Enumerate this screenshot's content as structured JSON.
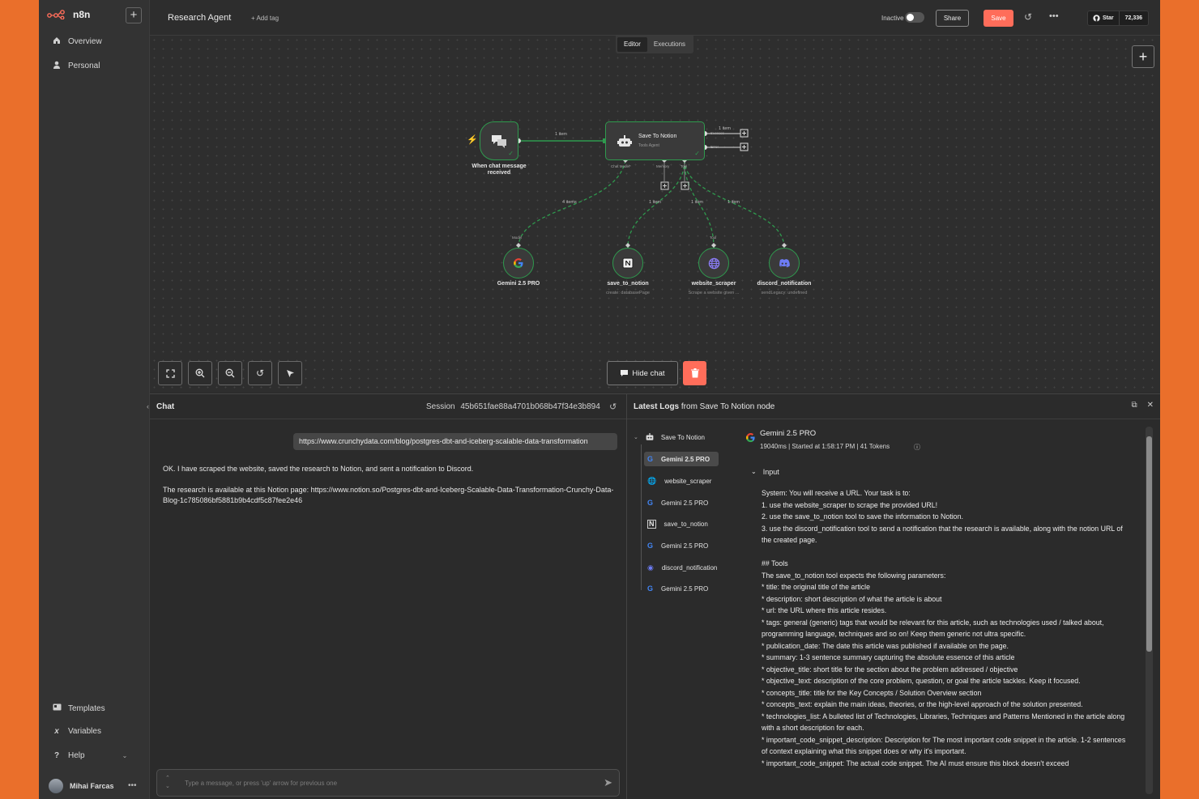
{
  "app": {
    "name": "n8n"
  },
  "sidebar": {
    "items": [
      {
        "label": "Overview",
        "icon": "home-icon"
      },
      {
        "label": "Personal",
        "icon": "user-icon"
      }
    ],
    "bottom_items": [
      {
        "label": "Templates",
        "icon": "templates-icon"
      },
      {
        "label": "Variables",
        "icon": "variables-icon"
      },
      {
        "label": "Help",
        "icon": "help-icon"
      }
    ],
    "user": "Mihai Farcas"
  },
  "header": {
    "workflow_title": "Research Agent",
    "add_tag": "+ Add tag",
    "status": "Inactive",
    "share": "Share",
    "save": "Save",
    "github_star": "Star",
    "github_count": "72,336"
  },
  "tabs": [
    {
      "label": "Editor"
    },
    {
      "label": "Executions"
    }
  ],
  "canvas": {
    "trigger": {
      "label_line1": "When chat message",
      "label_line2": "received"
    },
    "agent": {
      "title": "Save To Notion",
      "subtitle": "Tools Agent"
    },
    "ports": {
      "chat_model": "Chat Model*",
      "memory": "Memory",
      "tool": "Tool",
      "success": "Success",
      "error": "Error"
    },
    "edge_labels": {
      "main": "1 item",
      "success": "1 item",
      "model": "4 items",
      "notion": "1 item",
      "scraper": "1 item",
      "discord": "1 item"
    },
    "sub_port_labels": {
      "model": "Model",
      "tool": "Tool"
    },
    "sub_nodes": [
      {
        "label": "Gemini 2.5 PRO",
        "sub": "",
        "icon": "google-icon"
      },
      {
        "label": "save_to_notion",
        "sub": "create: databasePage",
        "icon": "notion-icon"
      },
      {
        "label": "website_scraper",
        "sub": "Scrape a website given ...",
        "icon": "globe-icon"
      },
      {
        "label": "discord_notification",
        "sub": "sendLegacy: undefined",
        "icon": "discord-icon"
      }
    ],
    "hide_chat": "Hide chat"
  },
  "chat": {
    "title": "Chat",
    "session_label": "Session",
    "session_id": "45b651fae88a4701b068b47f34e3b894",
    "user_message": "https://www.crunchydata.com/blog/postgres-dbt-and-iceberg-scalable-data-transformation",
    "bot_message_1": "OK. I have scraped the website, saved the research to Notion, and sent a notification to Discord.",
    "bot_message_2": "The research is available at this Notion page: https://www.notion.so/Postgres-dbt-and-Iceberg-Scalable-Data-Transformation-Crunchy-Data-Blog-1c785086bf5881b9b4cdf5c87fee2e46",
    "input_placeholder": "Type a message, or press 'up' arrow for previous one"
  },
  "logs": {
    "title_prefix": "Latest Logs",
    "title_suffix": "from Save To Notion node",
    "root": "Save To Notion",
    "items": [
      {
        "label": "Gemini 2.5 PRO",
        "icon": "google-icon",
        "selected": true
      },
      {
        "label": "website_scraper",
        "icon": "globe-icon",
        "selected": false
      },
      {
        "label": "Gemini 2.5 PRO",
        "icon": "google-icon",
        "selected": false
      },
      {
        "label": "save_to_notion",
        "icon": "notion-icon",
        "selected": false
      },
      {
        "label": "Gemini 2.5 PRO",
        "icon": "google-icon",
        "selected": false
      },
      {
        "label": "discord_notification",
        "icon": "discord-icon",
        "selected": false
      },
      {
        "label": "Gemini 2.5 PRO",
        "icon": "google-icon",
        "selected": false
      }
    ],
    "detail": {
      "title": "Gemini 2.5 PRO",
      "meta": "19040ms | Started at 1:58:17 PM | 41 Tokens",
      "input_label": "Input",
      "input_text": "System: You will receive a URL. Your task is to:\n1. use the website_scraper to scrape the provided URL!\n2. use the save_to_notion tool to save the information to Notion.\n3. use the discord_notification tool to send a notification that the research is available, along with the notion URL of the created page.\n\n## Tools\nThe save_to_notion tool expects the following parameters:\n* title: the original title of the article\n* description: short description of what the article is about\n* url: the URL where this article resides.\n* tags: general (generic) tags that would be relevant for this article, such as technologies used / talked about, programming language, techniques and so on! Keep them generic not ultra specific.\n* publication_date: The date this article was published if available on the page.\n* summary: 1-3 sentence summary capturing the absolute essence of this article\n* objective_title: short title for the section about the problem addressed / objective\n* objective_text: description of the core problem, question, or goal the article tackles. Keep it focused.\n* concepts_title: title for the Key Concepts / Solution Overview section\n* concepts_text: explain the main ideas, theories, or the high-level approach of the solution presented.\n* technologies_list: A bulleted list of Technologies, Libraries, Techniques and Patterns Mentioned in the article along with a short description for each.\n* important_code_snippet_description: Description for The most important code snippet in the article. 1-2 sentences of context explaining what this snippet does or why it's important.\n* important_code_snippet: The actual code snippet. The AI must ensure this block doesn't exceed"
    }
  },
  "colors": {
    "accent": "#ff6d5a",
    "success": "#2f9a4e",
    "background": "#2b2b2b",
    "frame": "#ea6f2b"
  }
}
